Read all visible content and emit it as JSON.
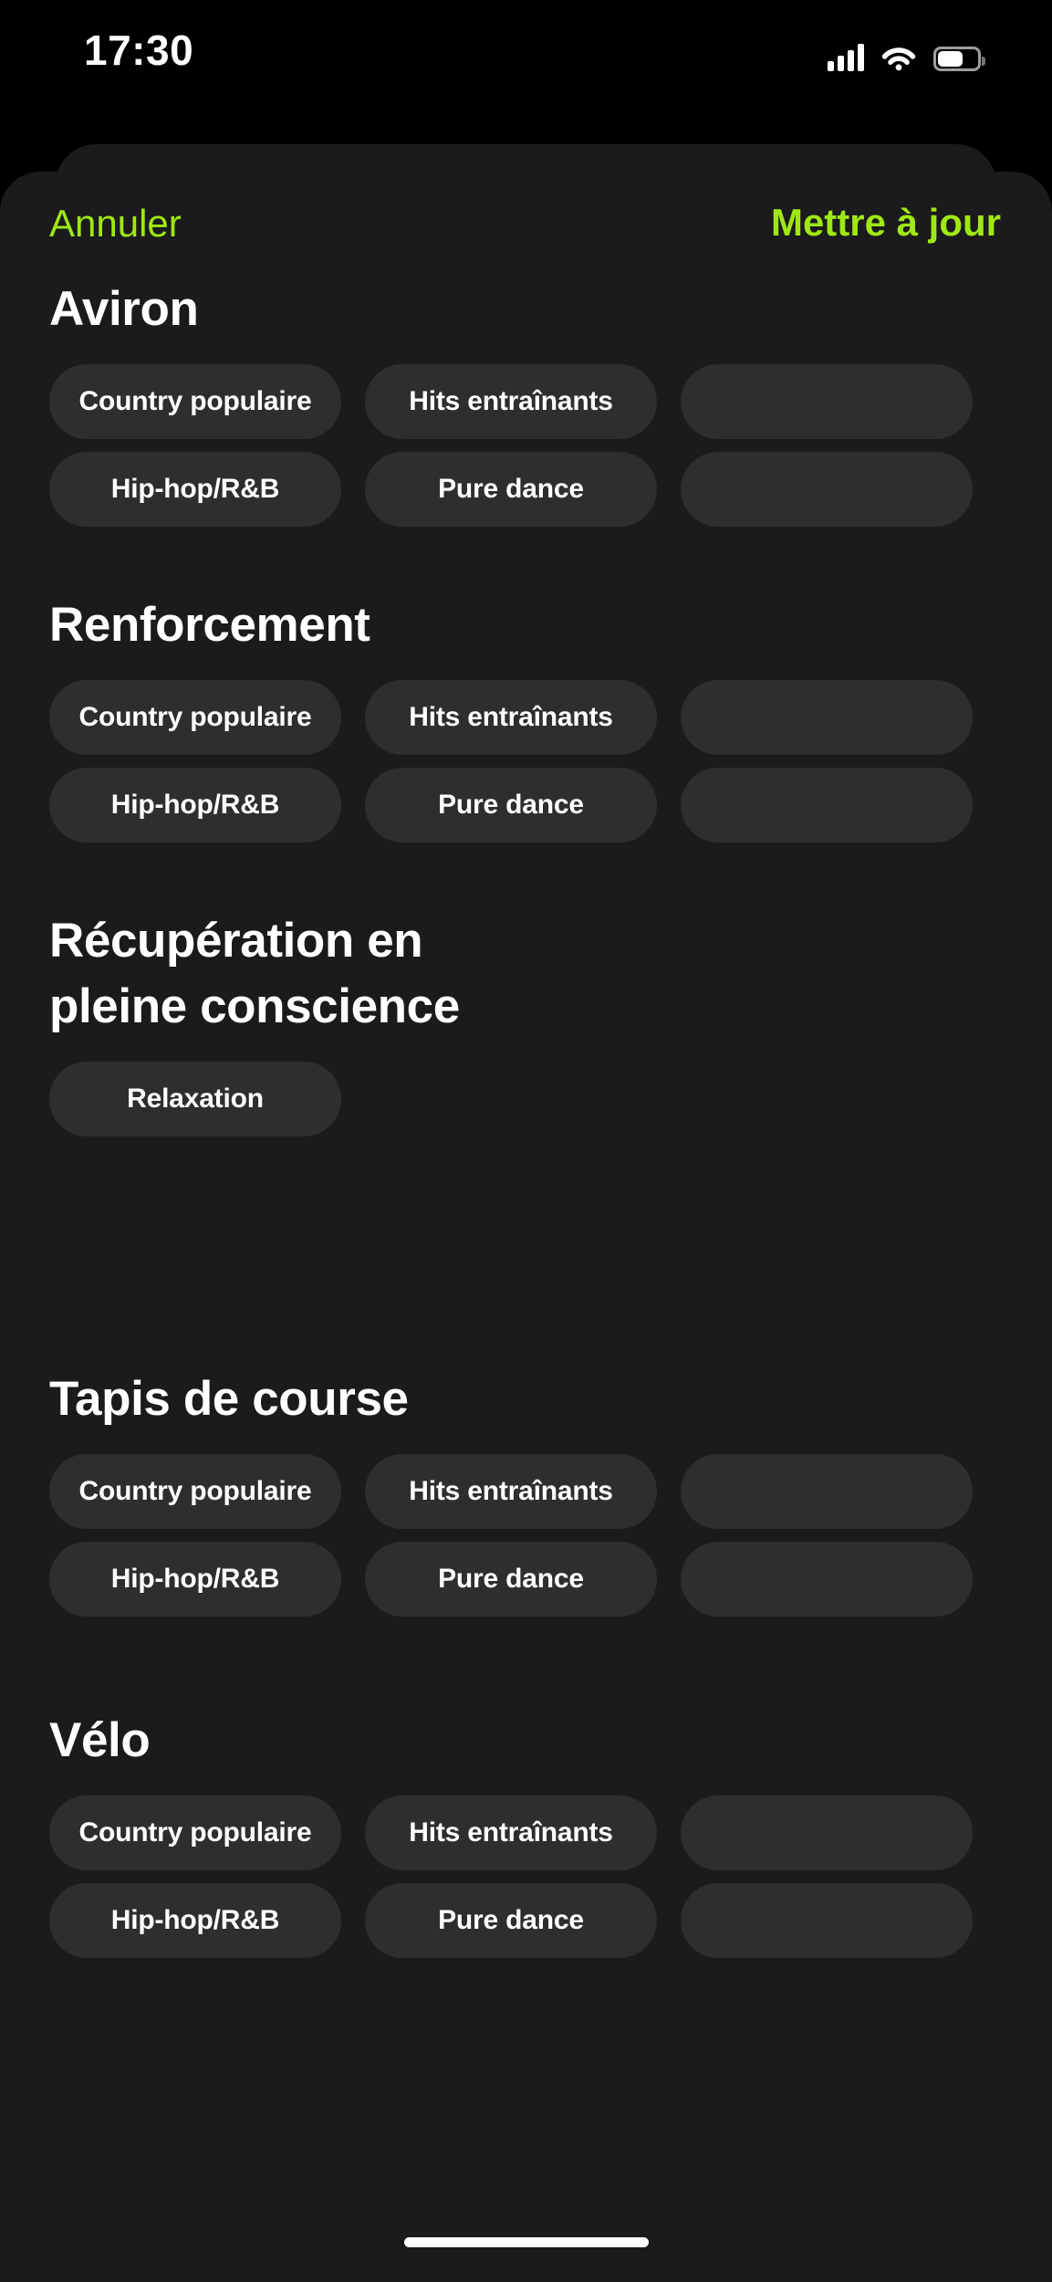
{
  "status_bar": {
    "time": "17:30",
    "icons": {
      "cellular": "cellular-signal-icon",
      "wifi": "wifi-icon",
      "battery": "battery-icon"
    }
  },
  "sheet": {
    "header": {
      "cancel_label": "Annuler",
      "update_label": "Mettre à jour"
    },
    "accent_color": "#9fe814",
    "surface_color": "#1b1b1d",
    "chip_color": "#2e2e31",
    "sections": [
      {
        "title": "Aviron",
        "rows": [
          [
            "Country populaire",
            "Hits entraînants",
            ""
          ],
          [
            "Hip-hop/R&B",
            "Pure dance",
            ""
          ]
        ]
      },
      {
        "title": "Renforcement",
        "rows": [
          [
            "Country populaire",
            "Hits entraînants",
            ""
          ],
          [
            "Hip-hop/R&B",
            "Pure dance",
            ""
          ]
        ]
      },
      {
        "title": "Récupération en pleine conscience",
        "rows": [
          [
            "Relaxation"
          ]
        ]
      },
      {
        "title": "Tapis de course",
        "rows": [
          [
            "Country populaire",
            "Hits entraînants",
            ""
          ],
          [
            "Hip-hop/R&B",
            "Pure dance",
            ""
          ]
        ]
      },
      {
        "title": "Vélo",
        "rows": [
          [
            "Country populaire",
            "Hits entraînants",
            ""
          ],
          [
            "Hip-hop/R&B",
            "Pure dance",
            ""
          ]
        ]
      }
    ]
  },
  "home_indicator": "home-indicator"
}
